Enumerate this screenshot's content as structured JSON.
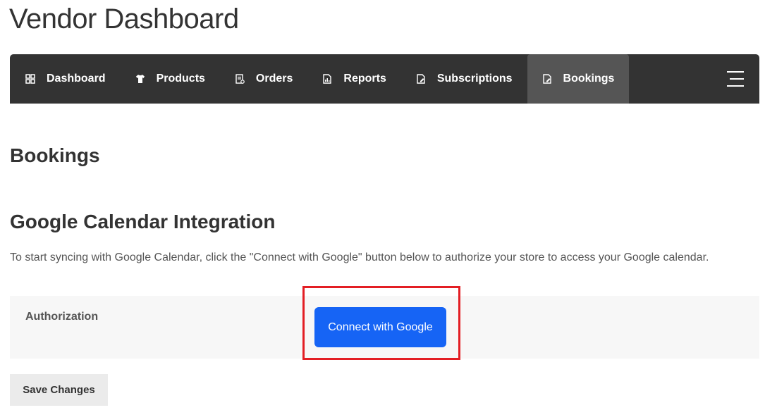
{
  "page": {
    "title": "Vendor Dashboard"
  },
  "nav": {
    "items": [
      {
        "label": "Dashboard",
        "icon": "grid-icon"
      },
      {
        "label": "Products",
        "icon": "shirt-icon"
      },
      {
        "label": "Orders",
        "icon": "receipt-icon"
      },
      {
        "label": "Reports",
        "icon": "report-icon"
      },
      {
        "label": "Subscriptions",
        "icon": "edit-document-icon"
      },
      {
        "label": "Bookings",
        "icon": "edit-document-icon",
        "active": true
      }
    ],
    "menu_icon": "hamburger-menu-icon"
  },
  "main": {
    "section_title": "Bookings",
    "subsection_title": "Google Calendar Integration",
    "description": "To start syncing with Google Calendar, click the \"Connect with Google\" button below to authorize your store to access your Google calendar.",
    "authorization_label": "Authorization",
    "connect_button": "Connect with Google",
    "save_button": "Save Changes"
  },
  "colors": {
    "navbar_bg": "#333333",
    "nav_active_bg": "#555555",
    "primary_button": "#1664f5",
    "highlight": "#e31e24"
  }
}
